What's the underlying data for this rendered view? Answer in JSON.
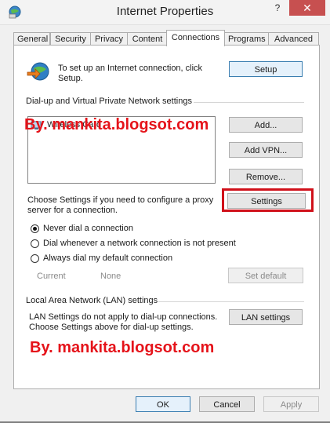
{
  "window": {
    "title": "Internet Properties",
    "help_glyph": "?",
    "close_glyph": "✕"
  },
  "tabs": [
    {
      "label": "General"
    },
    {
      "label": "Security"
    },
    {
      "label": "Privacy"
    },
    {
      "label": "Content"
    },
    {
      "label": "Connections"
    },
    {
      "label": "Programs"
    },
    {
      "label": "Advanced"
    }
  ],
  "active_tab": "Connections",
  "setup": {
    "text": "To set up an Internet connection, click Setup.",
    "button": "Setup"
  },
  "dialup": {
    "section_title": "Dial-up and Virtual Private Network settings",
    "list_items": [
      "Wireless Card"
    ],
    "add_button": "Add...",
    "add_vpn_button": "Add VPN...",
    "remove_button": "Remove...",
    "settings_text": "Choose Settings if you need to configure a proxy server for a connection.",
    "settings_button": "Settings",
    "radio_options": [
      {
        "label": "Never dial a connection",
        "checked": true
      },
      {
        "label": "Dial whenever a network connection is not present",
        "checked": false
      },
      {
        "label": "Always dial my default connection",
        "checked": false
      }
    ],
    "current_label": "Current",
    "current_value": "None",
    "set_default_button": "Set default"
  },
  "lan": {
    "section_title": "Local Area Network (LAN) settings",
    "text": "LAN Settings do not apply to dial-up connections. Choose Settings above for dial-up settings.",
    "button": "LAN settings"
  },
  "footer": {
    "ok": "OK",
    "cancel": "Cancel",
    "apply": "Apply"
  },
  "watermark_text": "By. mankita.blogsot.com",
  "colors": {
    "watermark": "#e5131a",
    "highlight": "#d0101a",
    "close_button": "#c75050"
  }
}
